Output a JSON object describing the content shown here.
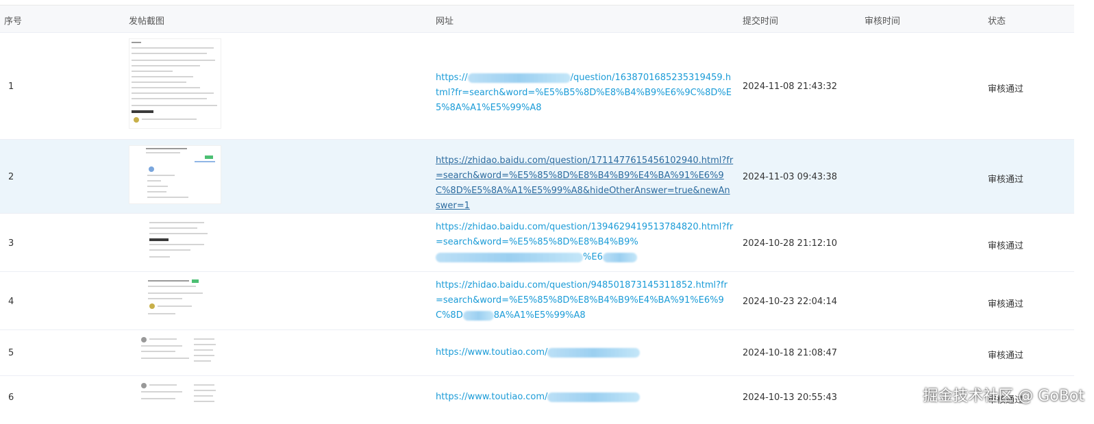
{
  "table": {
    "headers": {
      "index": "序号",
      "screenshot": "发帖截图",
      "url": "网址",
      "submit_time": "提交时间",
      "review_time": "审核时间",
      "status": "状态"
    },
    "rows": [
      {
        "index": "1",
        "url_visible": "https://",
        "url_tail_line1": "/question/1638701685235319459.html?fr=search",
        "url_line2": "&word=%E5%B5%8D%E8%B4%B9%E6%9C%8D%E5%8A%A1%E5%99%A8",
        "submit_time": "2024-11-08 21:43:32",
        "review_time": "",
        "status": "审核通过"
      },
      {
        "index": "2",
        "url_line1": "https://zhidao.baidu.com/question/1711477615456102940.html?fr=search",
        "url_line2": "&word=%E5%85%8D%E8%B4%B9%E4%BA%91%E6%9C%8D%E5%8A%A",
        "url_line3": "1%E5%99%A8&hideOtherAnswer=true&newAnswer=1",
        "submit_time": "2024-11-03 09:43:38",
        "review_time": "",
        "status": "审核通过"
      },
      {
        "index": "3",
        "url_line1": "https://zhidao.baidu.com/question/1394629419513784820.html?fr=search",
        "url_line2_start": "&word=%E5%85%8D%E8%B4%B9%",
        "url_line2_end": "%",
        "url_line3": "E6",
        "submit_time": "2024-10-28 21:12:10",
        "review_time": "",
        "status": "审核通过"
      },
      {
        "index": "4",
        "url_line1": "https://zhidao.baidu.com/question/948501873145311852.html?fr=search&",
        "url_line2_start": "word=%E5%85%8D%E8%B4%B9%E4%BA%91%E6%9C%8D",
        "url_line2_end": "8A%A1%E",
        "url_line3": "5%99%A8",
        "submit_time": "2024-10-23 22:04:14",
        "review_time": "",
        "status": "审核通过"
      },
      {
        "index": "5",
        "url_visible": "https://www.toutiao.com/",
        "submit_time": "2024-10-18 21:08:47",
        "review_time": "",
        "status": "审核通过"
      },
      {
        "index": "6",
        "url_visible": "https://www.toutiao.com/",
        "submit_time": "2024-10-13 20:55:43",
        "review_time": "",
        "status": "审核通过"
      }
    ]
  },
  "watermark": "掘金技术社区 @ GoBot",
  "colors": {
    "link": "#1a9bd7",
    "header_bg": "#f7f8fa",
    "highlight_row_bg": "#ecf5fb"
  }
}
